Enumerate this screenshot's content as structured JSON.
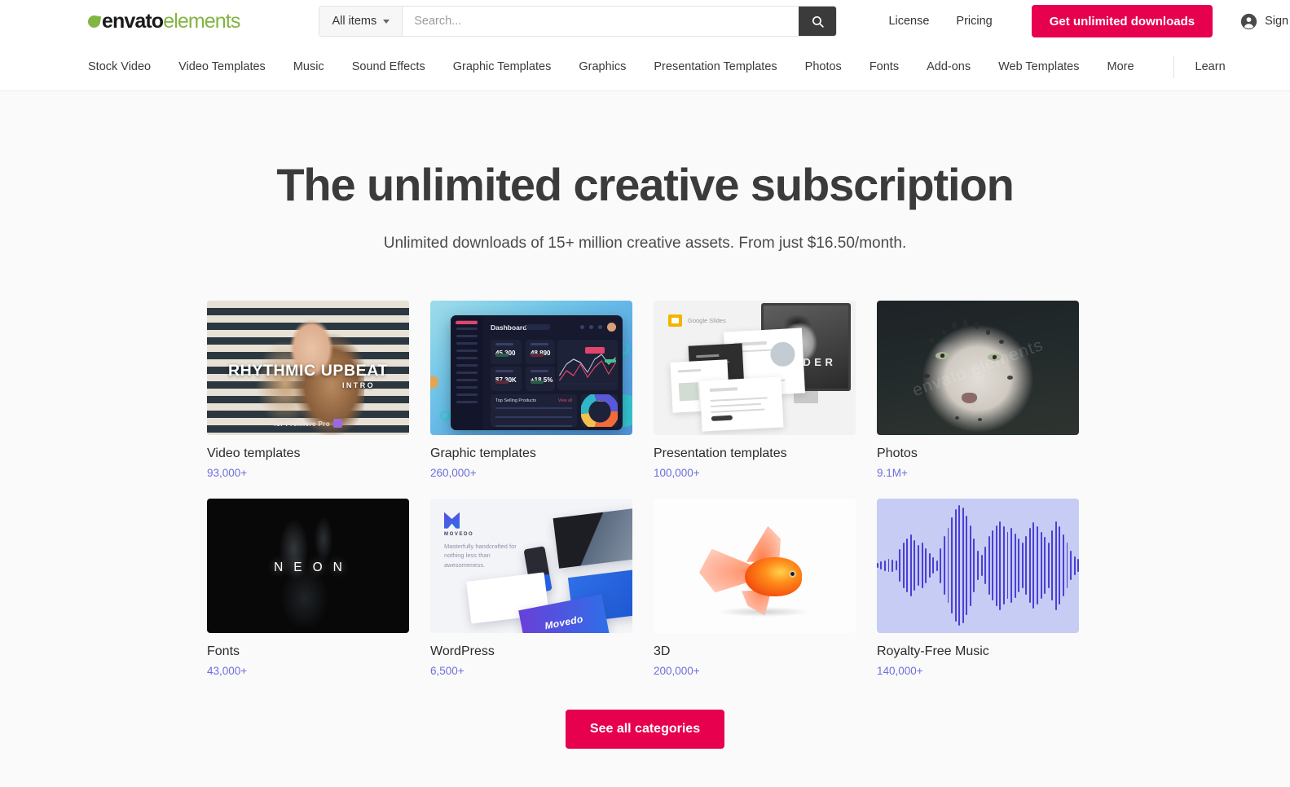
{
  "brand": {
    "name_bold": "envato",
    "name_light": "elements",
    "accent_pink": "#e6004d",
    "accent_green": "#82b541",
    "link_purple": "#6e6ee0"
  },
  "header": {
    "all_items_label": "All items",
    "search_placeholder": "Search...",
    "search_value": "",
    "links": [
      {
        "label": "License"
      },
      {
        "label": "Pricing"
      }
    ],
    "cta_label": "Get unlimited downloads",
    "signin_label": "Sign In"
  },
  "category_nav": {
    "items": [
      {
        "label": "Stock Video"
      },
      {
        "label": "Video Templates"
      },
      {
        "label": "Music"
      },
      {
        "label": "Sound Effects"
      },
      {
        "label": "Graphic Templates"
      },
      {
        "label": "Graphics"
      },
      {
        "label": "Presentation Templates"
      },
      {
        "label": "Photos"
      },
      {
        "label": "Fonts"
      },
      {
        "label": "Add-ons"
      },
      {
        "label": "Web Templates"
      },
      {
        "label": "More"
      }
    ],
    "learn_label": "Learn"
  },
  "hero": {
    "headline": "The unlimited creative subscription",
    "subheadline": "Unlimited downloads of 15+ million creative assets. From just $16.50/month."
  },
  "cards": [
    {
      "title": "Video templates",
      "count": "93,000+",
      "art": "video",
      "overlay_title": "RHYTHMIC UPBEAT",
      "overlay_sub": "INTRO",
      "overlay_foot": "for Premiere Pro"
    },
    {
      "title": "Graphic templates",
      "count": "260,000+",
      "art": "dash",
      "overlay_title": "Dashboard"
    },
    {
      "title": "Presentation templates",
      "count": "100,000+",
      "art": "pres",
      "overlay_title": "SLIDER",
      "logo_text": "Google",
      "logo_text_light": " Slides"
    },
    {
      "title": "Photos",
      "count": "9.1M+",
      "art": "leopard",
      "watermark": "envato elements"
    },
    {
      "title": "Fonts",
      "count": "43,000+",
      "art": "neon",
      "overlay_title": "NEON"
    },
    {
      "title": "WordPress",
      "count": "6,500+",
      "art": "wp",
      "overlay_title": "Movedo",
      "brand_name": "MOVEDO",
      "tagline": "Masterfully handcrafted for nothing less than awesomeness."
    },
    {
      "title": "3D",
      "count": "200,000+",
      "art": "fish"
    },
    {
      "title": "Royalty-Free Music",
      "count": "140,000+",
      "art": "wave"
    }
  ],
  "footer_action": {
    "see_all_label": "See all categories"
  },
  "waveform": {
    "bars": [
      4,
      6,
      8,
      10,
      9,
      7,
      24,
      34,
      40,
      46,
      38,
      30,
      34,
      26,
      18,
      12,
      8,
      26,
      44,
      56,
      72,
      84,
      90,
      86,
      74,
      60,
      40,
      22,
      16,
      28,
      44,
      52,
      60,
      66,
      58,
      50,
      56,
      48,
      40,
      34,
      44,
      56,
      64,
      58,
      50,
      42,
      34,
      52,
      66,
      58,
      46,
      34,
      22,
      14,
      10
    ]
  }
}
